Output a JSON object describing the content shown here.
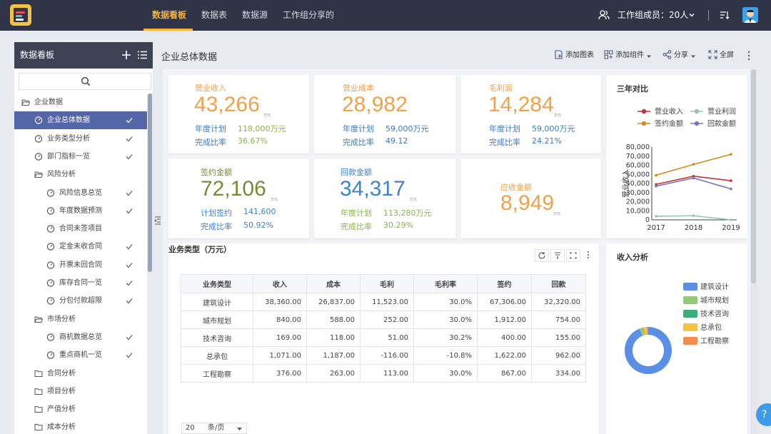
{
  "topbar": {
    "tabs": [
      "数据看板",
      "数据表",
      "数据源",
      "工作组分享的"
    ],
    "active_tab": 0,
    "members_label": "工作组成员：20人"
  },
  "sidebar": {
    "title": "数据看板",
    "tree": [
      {
        "label": "企业数据",
        "type": "folder-open",
        "level": 0
      },
      {
        "label": "企业总体数据",
        "type": "dash",
        "level": 1,
        "checked": true,
        "selected": true
      },
      {
        "label": "业务类型分析",
        "type": "dash",
        "level": 1,
        "checked": true
      },
      {
        "label": "部门指标一览",
        "type": "dash",
        "level": 1,
        "checked": true
      },
      {
        "label": "风险分析",
        "type": "folder-open",
        "level": 1
      },
      {
        "label": "风险信息总览",
        "type": "dash",
        "level": 2,
        "checked": true
      },
      {
        "label": "年度数据预测",
        "type": "dash",
        "level": 2,
        "checked": true
      },
      {
        "label": "合同未签项目",
        "type": "dash",
        "level": 2,
        "checked": false
      },
      {
        "label": "定金未收合同",
        "type": "dash",
        "level": 2,
        "checked": true
      },
      {
        "label": "开票未回合同",
        "type": "dash",
        "level": 2,
        "checked": true
      },
      {
        "label": "库存合同一览",
        "type": "dash",
        "level": 2,
        "checked": true
      },
      {
        "label": "分包付款超限",
        "type": "dash",
        "level": 2,
        "checked": true
      },
      {
        "label": "市场分析",
        "type": "folder-open",
        "level": 1
      },
      {
        "label": "商机数据总览",
        "type": "dash",
        "level": 2,
        "checked": true
      },
      {
        "label": "重点商机一览",
        "type": "dash",
        "level": 2,
        "checked": true
      },
      {
        "label": "合同分析",
        "type": "folder",
        "level": 1
      },
      {
        "label": "项目分析",
        "type": "folder",
        "level": 1
      },
      {
        "label": "产值分析",
        "type": "folder",
        "level": 1
      },
      {
        "label": "成本分析",
        "type": "folder",
        "level": 1
      }
    ]
  },
  "main": {
    "title": "企业总体数据",
    "toolbar": [
      "添加图表",
      "添加组件",
      "分享",
      "全屏"
    ]
  },
  "kpis": {
    "revenue": {
      "label": "营业收入",
      "value": "43,266",
      "unit": "万元",
      "plan_label": "年度计划",
      "plan": "118,000万元",
      "rate_label": "完成比率",
      "rate": "36.67%"
    },
    "cost": {
      "label": "营业成本",
      "value": "28,982",
      "unit": "万元",
      "plan_label": "年度计划",
      "plan": "59,000万元",
      "rate_label": "完成比率",
      "rate": "49.12"
    },
    "profit": {
      "label": "毛利润",
      "value": "14,284",
      "unit": "万元",
      "plan_label": "年度计划",
      "plan": "59,000万元",
      "rate_label": "完成比率",
      "rate": "24.21%"
    },
    "signed": {
      "label": "签约金额",
      "value": "72,106",
      "unit": "万元",
      "plan_label": "计划签约",
      "plan": "141,600",
      "rate_label": "完成比率",
      "rate": "50.92%"
    },
    "received": {
      "label": "回款金额",
      "value": "34,317",
      "unit": "万元",
      "plan_label": "年度计划",
      "plan": "113,280万元",
      "rate_label": "完成比率",
      "rate": "30.29%"
    },
    "receivable": {
      "label": "应收金额",
      "value": "8,949",
      "unit": "万元"
    }
  },
  "business_table": {
    "title": "业务类型（万元）",
    "columns": [
      "业务类型",
      "收入",
      "成本",
      "毛利",
      "毛利率",
      "签约",
      "回款"
    ],
    "rows": [
      [
        "建筑设计",
        "38,360.00",
        "26,837.00",
        "11,523.00",
        "30.0%",
        "67,306.00",
        "32,320.00"
      ],
      [
        "城市规划",
        "840.00",
        "588.00",
        "252.00",
        "30.0%",
        "1,912.00",
        "754.00"
      ],
      [
        "技术咨询",
        "169.00",
        "118.00",
        "51.00",
        "30.2%",
        "400.00",
        "155.00"
      ],
      [
        "总承包",
        "1,071.00",
        "1,187.00",
        "-116.00",
        "-10.8%",
        "1,622.00",
        "962.00"
      ],
      [
        "工程勘察",
        "376.00",
        "263.00",
        "113.00",
        "30.0%",
        "867.00",
        "334.00"
      ]
    ],
    "page_size": "20",
    "page_size_unit": "条/页"
  },
  "chart_data": [
    {
      "type": "line",
      "title": "三年对比",
      "x": [
        "2017",
        "2018",
        "2019"
      ],
      "ylabel": "营业收入",
      "ylim": [
        0,
        80000
      ],
      "yticks": [
        "0",
        "10,000",
        "20,000",
        "30,000",
        "40,000",
        "50,000",
        "60,000",
        "70,000",
        "80,000"
      ],
      "grid": false,
      "legend": "top",
      "series": [
        {
          "name": "营业收入",
          "color": "#c23531",
          "values": [
            39000,
            48000,
            43000
          ]
        },
        {
          "name": "营业利润",
          "color": "#91c7ae",
          "values": [
            4000,
            4500,
            0
          ]
        },
        {
          "name": "签约金额",
          "color": "#d48a1f",
          "values": [
            49000,
            61000,
            72000
          ]
        },
        {
          "name": "回款金额",
          "color": "#7b74c6",
          "values": [
            37000,
            46000,
            34000
          ]
        }
      ]
    },
    {
      "type": "pie",
      "title": "收入分析",
      "legend": "right",
      "categories": [
        "建筑设计",
        "城市规划",
        "技术咨询",
        "总承包",
        "工程勘察"
      ],
      "values": [
        38360,
        840,
        169,
        1071,
        376
      ],
      "colors": [
        "#5b8ee6",
        "#91cc75",
        "#3aae7a",
        "#f5c242",
        "#f58b4c"
      ]
    }
  ],
  "help": {
    "label": "?"
  }
}
